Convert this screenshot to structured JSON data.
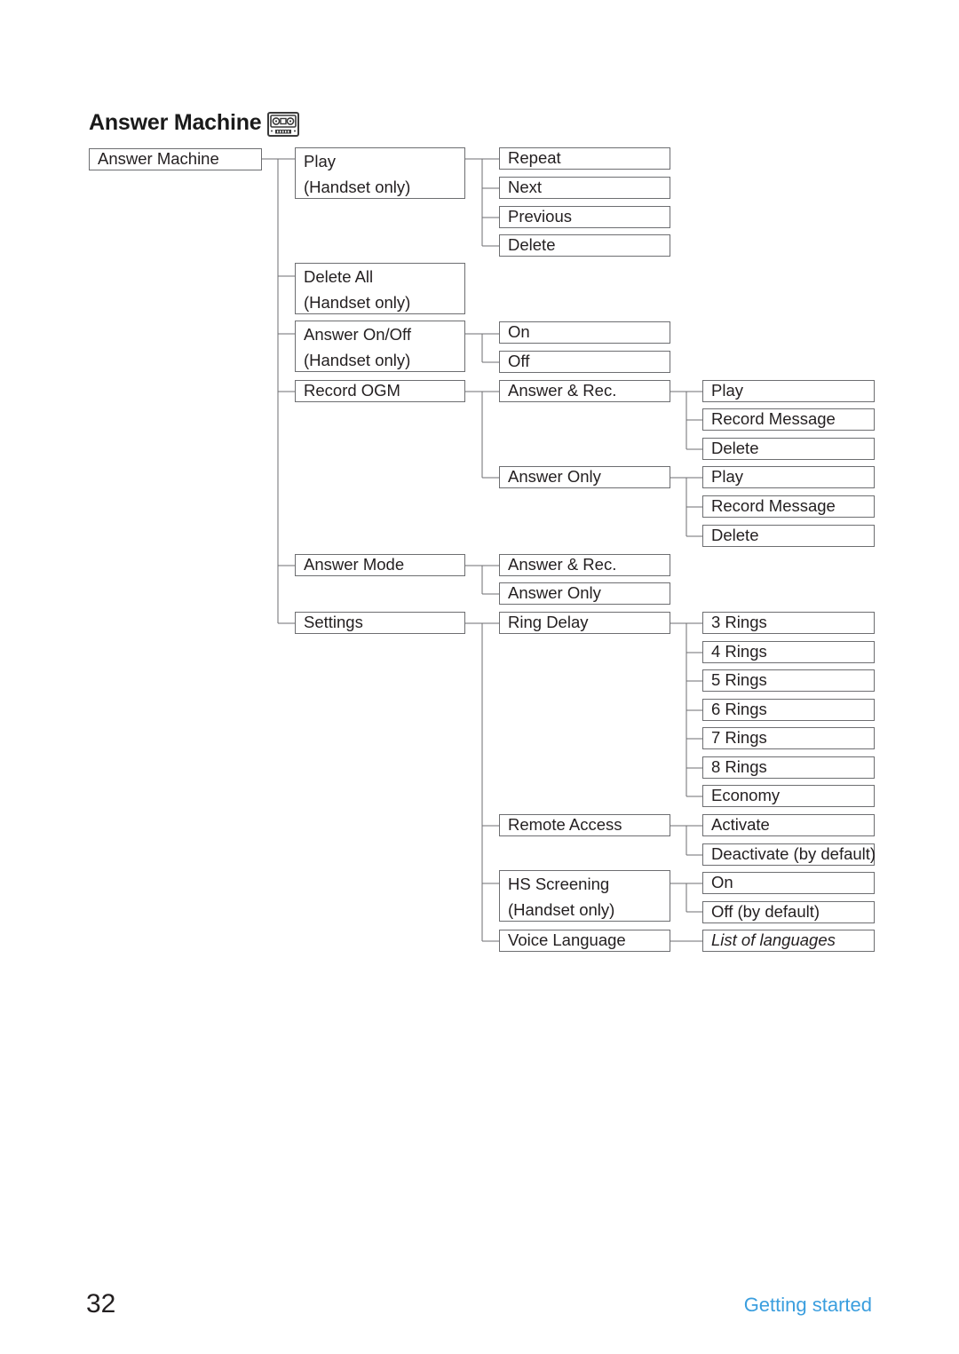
{
  "page": {
    "title": "Answer Machine",
    "title_icon": "cassette-tape-icon",
    "number": "32",
    "section": "Getting started",
    "accent_color": "#3b9ede",
    "box_border_color": "#6d6e71",
    "text_color": "#231f20"
  },
  "tree": {
    "root": {
      "label": "Answer Machine"
    },
    "nodes": [
      {
        "id": "play",
        "line1": "Play",
        "line2": "(Handset only)"
      },
      {
        "id": "play-repeat",
        "line1": "Repeat",
        "line2": ""
      },
      {
        "id": "play-next",
        "line1": "Next",
        "line2": ""
      },
      {
        "id": "play-previous",
        "line1": "Previous",
        "line2": ""
      },
      {
        "id": "play-delete",
        "line1": "Delete",
        "line2": ""
      },
      {
        "id": "delete-all",
        "line1": "Delete All",
        "line2": "(Handset only)"
      },
      {
        "id": "answer-on-off",
        "line1": "Answer On/Off",
        "line2": "(Handset only)"
      },
      {
        "id": "answer-on",
        "line1": "On",
        "line2": ""
      },
      {
        "id": "answer-off",
        "line1": "Off",
        "line2": ""
      },
      {
        "id": "record-ogm",
        "line1": "Record OGM",
        "line2": ""
      },
      {
        "id": "ogm-ar",
        "line1": "Answer & Rec.",
        "line2": ""
      },
      {
        "id": "ogm-ar-play",
        "line1": "Play",
        "line2": ""
      },
      {
        "id": "ogm-ar-record",
        "line1": "Record Message",
        "line2": ""
      },
      {
        "id": "ogm-ar-delete",
        "line1": "Delete",
        "line2": ""
      },
      {
        "id": "ogm-ao",
        "line1": "Answer Only",
        "line2": ""
      },
      {
        "id": "ogm-ao-play",
        "line1": "Play",
        "line2": ""
      },
      {
        "id": "ogm-ao-record",
        "line1": "Record Message",
        "line2": ""
      },
      {
        "id": "ogm-ao-delete",
        "line1": "Delete",
        "line2": ""
      },
      {
        "id": "answer-mode",
        "line1": "Answer Mode",
        "line2": ""
      },
      {
        "id": "mode-ar",
        "line1": "Answer & Rec.",
        "line2": ""
      },
      {
        "id": "mode-ao",
        "line1": "Answer Only",
        "line2": ""
      },
      {
        "id": "settings",
        "line1": "Settings",
        "line2": ""
      },
      {
        "id": "ring-delay",
        "line1": "Ring Delay",
        "line2": ""
      },
      {
        "id": "ring-3",
        "line1": "3 Rings",
        "line2": ""
      },
      {
        "id": "ring-4",
        "line1": "4 Rings",
        "line2": ""
      },
      {
        "id": "ring-5",
        "line1": "5 Rings",
        "line2": ""
      },
      {
        "id": "ring-6",
        "line1": "6 Rings",
        "line2": ""
      },
      {
        "id": "ring-7",
        "line1": "7 Rings",
        "line2": ""
      },
      {
        "id": "ring-8",
        "line1": "8 Rings",
        "line2": ""
      },
      {
        "id": "ring-economy",
        "line1": "Economy",
        "line2": ""
      },
      {
        "id": "remote-access",
        "line1": "Remote Access",
        "line2": ""
      },
      {
        "id": "remote-activate",
        "line1": "Activate",
        "line2": ""
      },
      {
        "id": "remote-deactivate",
        "line1": "Deactivate (by default)",
        "line2": ""
      },
      {
        "id": "hs-screening",
        "line1": "HS Screening",
        "line2": "(Handset only)"
      },
      {
        "id": "hs-on",
        "line1": "On",
        "line2": ""
      },
      {
        "id": "hs-off",
        "line1": "Off (by default)",
        "line2": ""
      },
      {
        "id": "voice-language",
        "line1": "Voice Language",
        "line2": ""
      },
      {
        "id": "language-list",
        "line1": "List of languages",
        "line2": ""
      }
    ]
  }
}
